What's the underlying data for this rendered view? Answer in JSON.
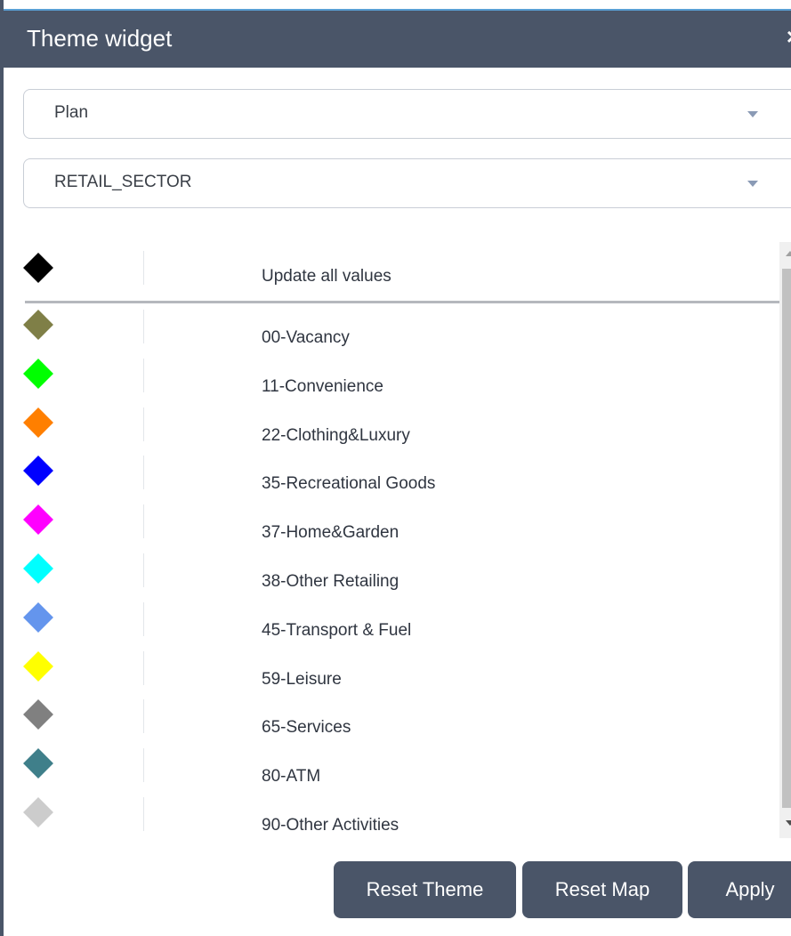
{
  "window": {
    "title": "Theme widget",
    "close_label": "×"
  },
  "selects": {
    "layer": {
      "value": "Plan"
    },
    "field": {
      "value": "RETAIL_SECTOR"
    }
  },
  "legend": {
    "header": {
      "label": "Update all values",
      "color": "#000000"
    },
    "items": [
      {
        "label": "00-Vacancy",
        "color": "#7f7f47"
      },
      {
        "label": "11-Convenience",
        "color": "#00ff00"
      },
      {
        "label": "22-Clothing&Luxury",
        "color": "#ff7f00"
      },
      {
        "label": "35-Recreational Goods",
        "color": "#0000ff"
      },
      {
        "label": "37-Home&Garden",
        "color": "#ff00ff"
      },
      {
        "label": "38-Other Retailing",
        "color": "#00ffff"
      },
      {
        "label": "45-Transport & Fuel",
        "color": "#6495ed"
      },
      {
        "label": "59-Leisure",
        "color": "#ffff00"
      },
      {
        "label": "65-Services",
        "color": "#808080"
      },
      {
        "label": "80-ATM",
        "color": "#3f7f8a"
      },
      {
        "label": "90-Other Activities",
        "color": "#cccccc"
      }
    ]
  },
  "buttons": {
    "reset_theme": "Reset Theme",
    "reset_map": "Reset Map",
    "apply": "Apply"
  }
}
